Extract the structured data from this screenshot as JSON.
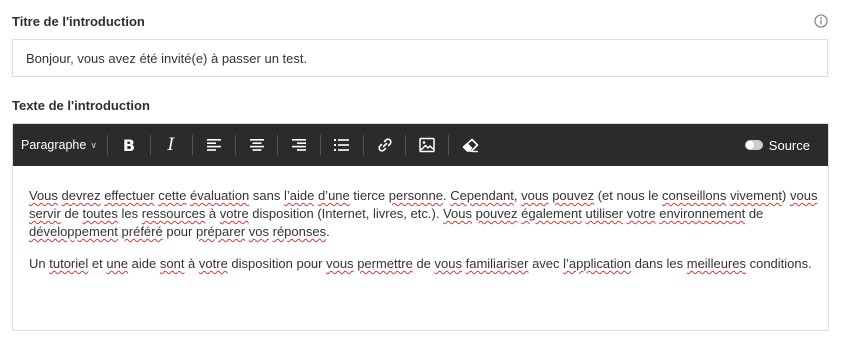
{
  "title_field": {
    "label": "Titre de l'introduction",
    "value": "Bonjour, vous avez été invité(e) à passer un test.",
    "info_icon": "info-circle-icon"
  },
  "text_field": {
    "label": "Texte de l'introduction"
  },
  "toolbar": {
    "paragraph_label": "Paragraphe",
    "paragraph_chevron": "∨",
    "bold": "B",
    "italic": "I",
    "source_label": "Source",
    "icons": [
      "bold-icon",
      "italic-icon",
      "align-left-icon",
      "align-center-icon",
      "align-right-icon",
      "bulleted-list-icon",
      "link-icon",
      "image-icon",
      "eraser-icon",
      "toggle-icon"
    ]
  },
  "content": {
    "paragraph1": [
      {
        "t": "Vous",
        "s": true
      },
      {
        "t": " "
      },
      {
        "t": "devrez",
        "s": true
      },
      {
        "t": " "
      },
      {
        "t": "effectuer",
        "s": true
      },
      {
        "t": " "
      },
      {
        "t": "cette",
        "s": true
      },
      {
        "t": " "
      },
      {
        "t": "évaluation",
        "s": true
      },
      {
        "t": " sans "
      },
      {
        "t": "l’aide",
        "s": true
      },
      {
        "t": " "
      },
      {
        "t": "d’une",
        "s": true
      },
      {
        "t": " tierce "
      },
      {
        "t": "personne",
        "s": true
      },
      {
        "t": ". "
      },
      {
        "t": "Cependant",
        "s": true
      },
      {
        "t": ", "
      },
      {
        "t": "vous",
        "s": true
      },
      {
        "t": " "
      },
      {
        "t": "pouvez",
        "s": true
      },
      {
        "t": " (et nous le "
      },
      {
        "t": "conseillons",
        "s": true
      },
      {
        "t": " "
      },
      {
        "t": "vivement",
        "s": true
      },
      {
        "t": ") "
      },
      {
        "t": "vous",
        "s": true
      },
      {
        "t": " "
      },
      {
        "t": "servir",
        "s": true
      },
      {
        "t": " de "
      },
      {
        "t": "toutes",
        "s": true
      },
      {
        "t": " les "
      },
      {
        "t": "ressources",
        "s": true
      },
      {
        "t": " à "
      },
      {
        "t": "votre",
        "s": true
      },
      {
        "t": " disposition (Internet, livres, etc.). "
      },
      {
        "t": "Vous",
        "s": true
      },
      {
        "t": " "
      },
      {
        "t": "pouvez",
        "s": true
      },
      {
        "t": " "
      },
      {
        "t": "également",
        "s": true
      },
      {
        "t": " "
      },
      {
        "t": "utiliser",
        "s": true
      },
      {
        "t": " "
      },
      {
        "t": "votre",
        "s": true
      },
      {
        "t": " "
      },
      {
        "t": "environnement",
        "s": true
      },
      {
        "t": " de "
      },
      {
        "t": "développement",
        "s": true
      },
      {
        "t": " "
      },
      {
        "t": "préféré",
        "s": true
      },
      {
        "t": " pour "
      },
      {
        "t": "préparer",
        "s": true
      },
      {
        "t": " "
      },
      {
        "t": "vos",
        "s": true
      },
      {
        "t": " "
      },
      {
        "t": "réponses",
        "s": true
      },
      {
        "t": "."
      }
    ],
    "paragraph2": [
      {
        "t": "Un "
      },
      {
        "t": "tutoriel",
        "s": true
      },
      {
        "t": " et "
      },
      {
        "t": "une",
        "s": true
      },
      {
        "t": " aide "
      },
      {
        "t": "sont",
        "s": true
      },
      {
        "t": " à "
      },
      {
        "t": "votre",
        "s": true
      },
      {
        "t": " disposition pour "
      },
      {
        "t": "vous",
        "s": true
      },
      {
        "t": " "
      },
      {
        "t": "permettre",
        "s": true
      },
      {
        "t": " de "
      },
      {
        "t": "vous",
        "s": true
      },
      {
        "t": " "
      },
      {
        "t": "familiariser",
        "s": true
      },
      {
        "t": " avec "
      },
      {
        "t": "l’application",
        "s": true
      },
      {
        "t": " dans les "
      },
      {
        "t": "meilleures",
        "s": true
      },
      {
        "t": " conditions."
      }
    ]
  }
}
